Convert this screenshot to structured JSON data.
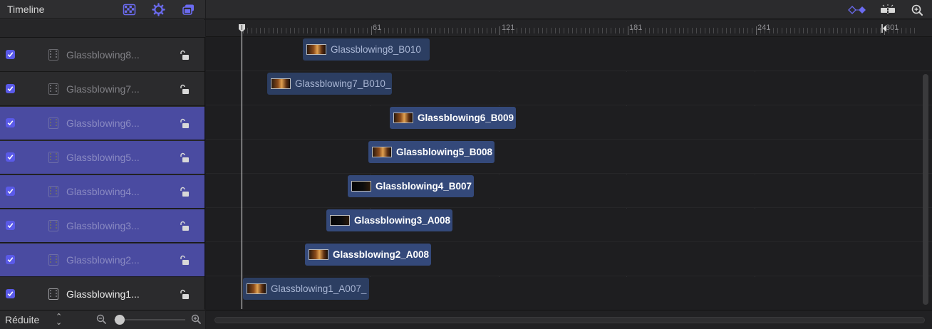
{
  "panel": {
    "title": "Timeline",
    "icons": [
      "checkerboard-icon",
      "gear-icon",
      "layers-icon"
    ]
  },
  "toolbar_right": {
    "icons": [
      "keyframe-diamonds-icon",
      "snapping-icon",
      "zoom-icon"
    ]
  },
  "ruler": {
    "labels": [
      "61",
      "121",
      "181",
      "241",
      "301"
    ]
  },
  "layers": [
    {
      "name": "Glassblowing8...",
      "checked": true,
      "selected": false,
      "locked": false
    },
    {
      "name": "Glassblowing7...",
      "checked": true,
      "selected": false,
      "locked": false
    },
    {
      "name": "Glassblowing6...",
      "checked": true,
      "selected": true,
      "locked": false
    },
    {
      "name": "Glassblowing5...",
      "checked": true,
      "selected": true,
      "locked": false
    },
    {
      "name": "Glassblowing4...",
      "checked": true,
      "selected": true,
      "locked": false
    },
    {
      "name": "Glassblowing3...",
      "checked": true,
      "selected": true,
      "locked": false
    },
    {
      "name": "Glassblowing2...",
      "checked": true,
      "selected": true,
      "locked": false
    },
    {
      "name": "Glassblowing1...",
      "checked": true,
      "selected": false,
      "locked": false
    }
  ],
  "clips": [
    {
      "label": "Glassblowing8_B010",
      "selected": false
    },
    {
      "label": "Glassblowing7_B010_",
      "selected": false
    },
    {
      "label": "Glassblowing6_B009",
      "selected": true
    },
    {
      "label": "Glassblowing5_B008",
      "selected": true
    },
    {
      "label": "Glassblowing4_B007",
      "selected": true
    },
    {
      "label": "Glassblowing3_A008",
      "selected": true
    },
    {
      "label": "Glassblowing2_A008",
      "selected": true
    },
    {
      "label": "Glassblowing1_A007_",
      "selected": false
    }
  ],
  "footer": {
    "view_mode": "Réduite"
  },
  "colors": {
    "accent": "#5a5ae8",
    "selected_row": "#4a4ba1",
    "clip": "#2c3e62",
    "clip_selected": "#34497a"
  }
}
